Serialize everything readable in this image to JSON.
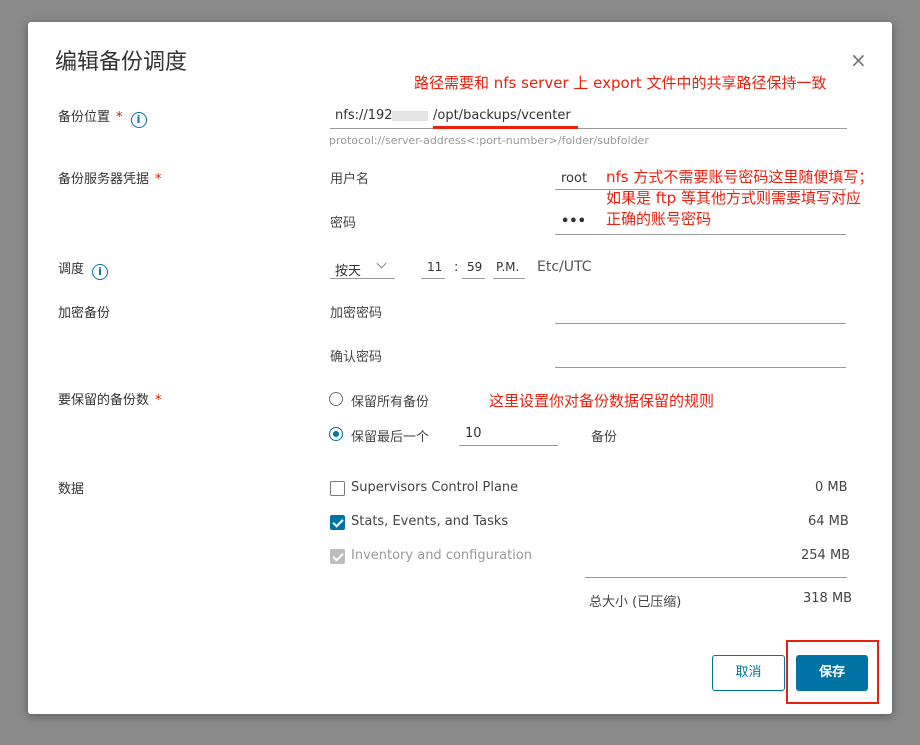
{
  "dialog": {
    "title": "编辑备份调度",
    "close_glyph": "×"
  },
  "annotations": {
    "path_note": "路径需要和 nfs server 上 export 文件中的共享路径保持一致",
    "cred_note_1": "nfs 方式不需要账号密码这里随便填写；",
    "cred_note_2": "如果是 ftp 等其他方式则需要填写对应",
    "cred_note_3": "正确的账号密码",
    "retention_note": "这里设置你对备份数据保留的规则"
  },
  "location": {
    "label": "备份位置",
    "required": "*",
    "info": "i",
    "value_prefix": "nfs://192",
    "value_suffix": "/opt/backups/vcenter",
    "hint": "protocol://server-address<:port-number>/folder/subfolder"
  },
  "credentials": {
    "label": "备份服务器凭据",
    "required": "*",
    "username_label": "用户名",
    "username_value": "root",
    "password_label": "密码",
    "password_value": "•••"
  },
  "schedule": {
    "label": "调度",
    "info": "i",
    "frequency": "按天",
    "hour": "11",
    "separator": ":",
    "minute": "59",
    "ampm": "P.M.",
    "timezone": "Etc/UTC"
  },
  "encryption": {
    "label": "加密备份",
    "password_label": "加密密码",
    "confirm_label": "确认密码"
  },
  "retention": {
    "label": "要保留的备份数",
    "required": "*",
    "keep_all": "保留所有备份",
    "keep_last": "保留最后一个",
    "keep_last_value": "10",
    "unit": "备份"
  },
  "data": {
    "label": "数据",
    "items": [
      {
        "name": "Supervisors Control Plane",
        "size": "0 MB"
      },
      {
        "name": "Stats, Events, and Tasks",
        "size": "64 MB"
      },
      {
        "name": "Inventory and configuration",
        "size": "254 MB"
      }
    ],
    "total_label": "总大小 (已压缩)",
    "total_value": "318 MB"
  },
  "buttons": {
    "cancel": "取消",
    "save": "保存"
  },
  "colors": {
    "accent": "#0072a3",
    "annotation_red": "#e8210f",
    "required_red": "#c92100"
  }
}
